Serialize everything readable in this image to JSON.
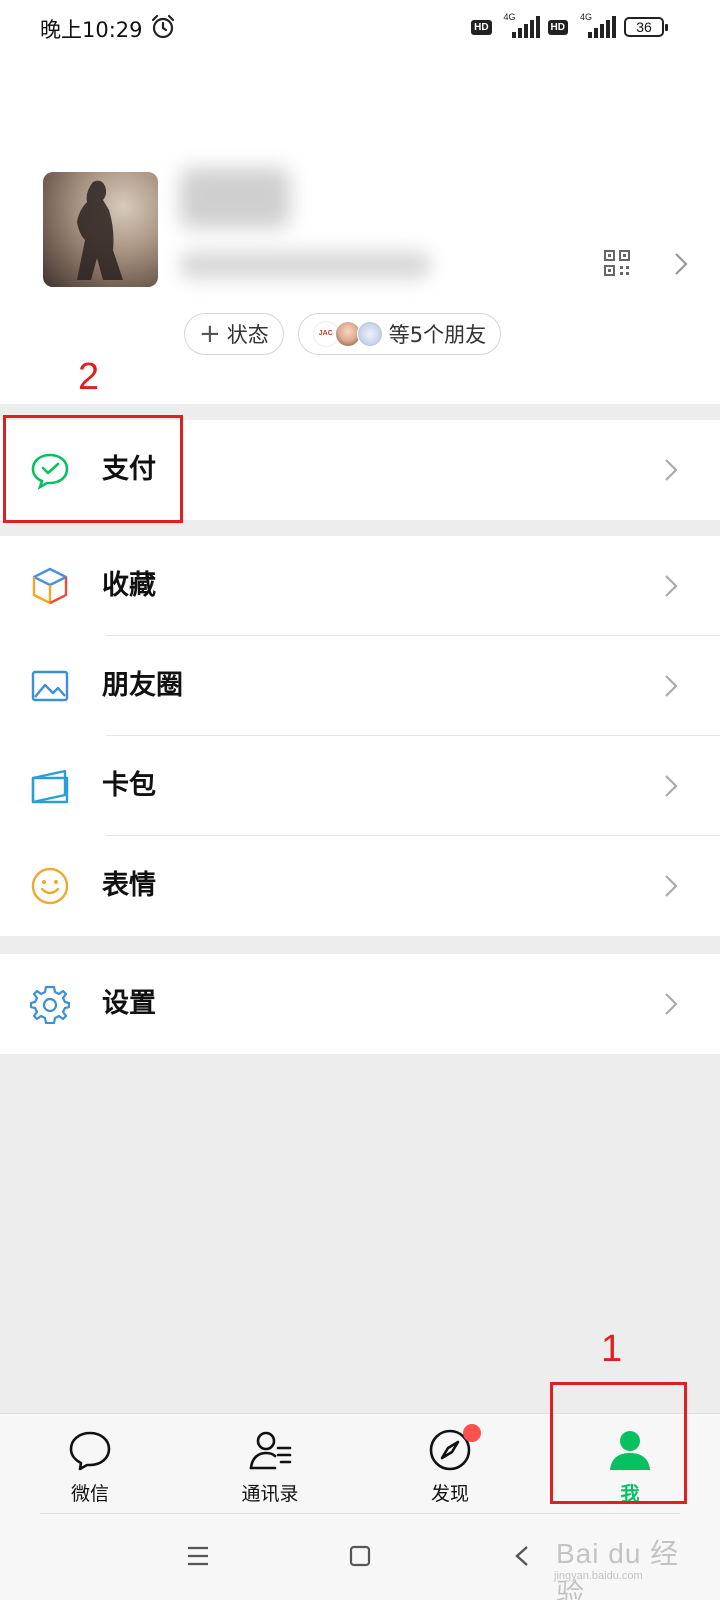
{
  "status_bar": {
    "time": "晚上10:29",
    "hd1": "HD",
    "net1": "4G",
    "hd2": "HD",
    "net2": "4G",
    "battery": "36"
  },
  "profile": {
    "status_chip": "状态",
    "friends_chip": "等5个朋友",
    "mini_avatar_text": "JAC"
  },
  "annotations": {
    "num_pay": "2",
    "num_me": "1"
  },
  "menu": {
    "pay": "支付",
    "favorites": "收藏",
    "moments": "朋友圈",
    "cards": "卡包",
    "stickers": "表情",
    "settings": "设置"
  },
  "tabs": {
    "chats": "微信",
    "contacts": "通讯录",
    "discover": "发现",
    "me": "我"
  },
  "watermark": {
    "brand": "Bai du 经验",
    "url": "jingyan.baidu.com"
  },
  "colors": {
    "accent_green": "#07c160",
    "annotation_red": "#e02020",
    "badge_red": "#fa5151",
    "background": "#ededed"
  },
  "icons": {
    "alarm": "alarm-clock-icon",
    "qr": "qr-code-icon",
    "pay": "wechat-pay-icon",
    "favorites": "cube-icon",
    "moments": "image-icon",
    "cards": "card-wallet-icon",
    "stickers": "smiley-icon",
    "settings": "gear-icon",
    "chats": "chat-bubble-icon",
    "contacts": "contacts-icon",
    "discover": "compass-icon",
    "me": "person-icon"
  }
}
